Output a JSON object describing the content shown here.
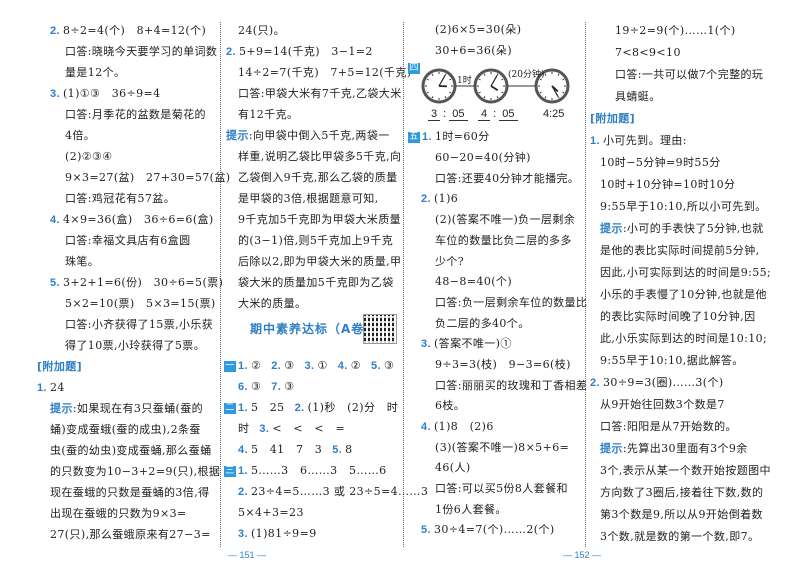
{
  "columns": [
    [
      {
        "type": "q",
        "n": "2.",
        "t": "8÷2=4(个)　8+4=12(个)"
      },
      {
        "type": "c",
        "t": "口答:晓晓今天要学习的单词数"
      },
      {
        "type": "c",
        "t": "量是12个。"
      },
      {
        "type": "q",
        "n": "3.",
        "t": "(1)①③　36÷9=4"
      },
      {
        "type": "c",
        "t": "口答:月季花的盆数是菊花的"
      },
      {
        "type": "c",
        "t": "4倍。"
      },
      {
        "type": "c",
        "t": "(2)②③④"
      },
      {
        "type": "c",
        "t": "9×3=27(盆)　27+30=57(盆)"
      },
      {
        "type": "c",
        "t": "口答:鸡冠花有57盆。"
      },
      {
        "type": "q",
        "n": "4.",
        "t": "4×9=36(盒)　36÷6=6(盒)"
      },
      {
        "type": "c",
        "t": "口答:幸福文具店有6盒圆"
      },
      {
        "type": "c",
        "t": "珠笔。"
      },
      {
        "type": "q",
        "n": "5.",
        "t": "3+2+1=6(份)　30÷6=5(票)"
      },
      {
        "type": "c",
        "t": "5×2=10(票)　5×3=15(票)"
      },
      {
        "type": "c",
        "t": "口答:小齐获得了15票,小乐获"
      },
      {
        "type": "c",
        "t": "得了10票,小玲获得了5票。"
      },
      {
        "type": "h",
        "t": "[附加题]"
      },
      {
        "type": "q0",
        "n": "1.",
        "t": "24"
      },
      {
        "type": "t",
        "tip": "提示",
        "t": ":如果现在有3只蚕蛹(蚕的"
      },
      {
        "type": "c1",
        "t": "蛹)变成蚕蛾(蚕的成虫),2条蚕"
      },
      {
        "type": "c1",
        "t": "虫(蚕的幼虫)变成蚕蛹,那么蚕蛹"
      },
      {
        "type": "c1",
        "t": "的只数变为10−3+2=9(只),根据"
      },
      {
        "type": "c1",
        "t": "现在蚕蛾的只数是蚕蛹的3倍,得"
      },
      {
        "type": "c1",
        "t": "出现在蚕蛾的只数为9×3="
      },
      {
        "type": "c1",
        "t": "27(只),那么蚕蛾原来有27−3="
      }
    ],
    [
      {
        "type": "c",
        "t": "24(只)。"
      },
      {
        "type": "q",
        "n": "2.",
        "t": "5+9=14(千克)　3−1=2"
      },
      {
        "type": "c",
        "t": "14÷2=7(千克)　7+5=12(千克)"
      },
      {
        "type": "c",
        "t": "口答:甲袋大米有7千克,乙袋大米"
      },
      {
        "type": "c",
        "t": "有12千克。"
      },
      {
        "type": "t",
        "tip": "提示",
        "t": ":向甲袋中倒入5千克,两袋一"
      },
      {
        "type": "c",
        "t": "样重,说明乙袋比甲袋多5千克,向"
      },
      {
        "type": "c",
        "t": "乙袋倒入9千克,那么乙袋的质量"
      },
      {
        "type": "c",
        "t": "是甲袋的3倍,根据题意可知,"
      },
      {
        "type": "c",
        "t": "9千克加5千克即为甲袋大米质量"
      },
      {
        "type": "c",
        "t": "的(3−1)倍,则5千克加上9千克"
      },
      {
        "type": "c",
        "t": "后除以2,即为甲袋大米的质量,甲"
      },
      {
        "type": "c",
        "t": "袋大米的质量加5千克即为乙袋"
      },
      {
        "type": "c",
        "t": "大米的质量。"
      },
      {
        "type": "title",
        "t": "期中素养达标（A卷）"
      },
      {
        "type": "s",
        "sec": "一",
        "parts": [
          {
            "n": "1.",
            "t": "②"
          },
          {
            "n": "2.",
            "t": "③"
          },
          {
            "n": "3.",
            "t": "①"
          },
          {
            "n": "4.",
            "t": "②"
          },
          {
            "n": "5.",
            "t": "③"
          }
        ]
      },
      {
        "type": "sc",
        "parts": [
          {
            "n": "6.",
            "t": "③"
          },
          {
            "n": "7.",
            "t": "③"
          }
        ]
      },
      {
        "type": "s",
        "sec": "二",
        "parts": [
          {
            "n": "1.",
            "t": "5　25"
          },
          {
            "n": "2.",
            "t": "(1)秒　(2)分　时"
          }
        ]
      },
      {
        "type": "sc",
        "parts": [
          {
            "t": "时"
          },
          {
            "n": "3.",
            "t": "<　<　<　="
          }
        ]
      },
      {
        "type": "sc",
        "parts": [
          {
            "n": "4.",
            "t": "5　41　7　3"
          },
          {
            "n": "5.",
            "t": "8"
          }
        ]
      },
      {
        "type": "s",
        "sec": "三",
        "parts": [
          {
            "n": "1.",
            "t": "5……3　6……3　5……6"
          }
        ]
      },
      {
        "type": "sc",
        "parts": [
          {
            "n": "2.",
            "t": "23÷4=5……3 或 23÷5=4……3"
          }
        ]
      },
      {
        "type": "c",
        "t": "5×4+3=23"
      },
      {
        "type": "sc",
        "parts": [
          {
            "n": "3.",
            "t": "(1)81÷9=9"
          }
        ]
      }
    ],
    [
      {
        "type": "c",
        "t": "(2)6×5=30(朵)"
      },
      {
        "type": "c",
        "t": "30+6=36(朵)"
      },
      {
        "type": "clocks"
      },
      {
        "type": "s",
        "sec": "五",
        "parts": [
          {
            "n": "1.",
            "t": "1时=60分"
          }
        ]
      },
      {
        "type": "c",
        "t": "60−20=40(分钟)"
      },
      {
        "type": "c",
        "t": "口答:还要40分钟才能播完。"
      },
      {
        "type": "q",
        "n": "2.",
        "t": "(1)6"
      },
      {
        "type": "c",
        "t": "(2)(答案不唯一)负一层剩余"
      },
      {
        "type": "c",
        "t": "车位的数量比负二层的多多"
      },
      {
        "type": "c",
        "t": "少个?"
      },
      {
        "type": "c",
        "t": "48−8=40(个)"
      },
      {
        "type": "c",
        "t": "口答:负一层剩余车位的数量比"
      },
      {
        "type": "c",
        "t": "负二层的多40个。"
      },
      {
        "type": "q",
        "n": "3.",
        "t": "(答案不唯一)①"
      },
      {
        "type": "c",
        "t": "9÷3=3(枝)　9−3=6(枝)"
      },
      {
        "type": "c",
        "t": "口答:丽丽买的玫瑰和丁香相差"
      },
      {
        "type": "c",
        "t": "6枝。"
      },
      {
        "type": "q",
        "n": "4.",
        "t": "(1)8　(2)6"
      },
      {
        "type": "c",
        "t": "(3)(答案不唯一)8×5+6="
      },
      {
        "type": "c",
        "t": "46(人)"
      },
      {
        "type": "c",
        "t": "口答:可以买5份8人套餐和"
      },
      {
        "type": "c",
        "t": "1份6人套餐。"
      },
      {
        "type": "q",
        "n": "5.",
        "t": "30÷4=7(个)……2(个)"
      }
    ],
    [
      {
        "type": "c",
        "t": "19÷2=9(个)……1(个)"
      },
      {
        "type": "c",
        "t": "7<8<9<10"
      },
      {
        "type": "c",
        "t": "口答:一共可以做7个完整的玩"
      },
      {
        "type": "c",
        "t": "具蜻蜓。"
      },
      {
        "type": "h",
        "t": "[附加题]"
      },
      {
        "type": "q0",
        "n": "1.",
        "t": "小可先到。理由:"
      },
      {
        "type": "c1",
        "t": "10时−5分钟=9时55分"
      },
      {
        "type": "c1",
        "t": "10时+10分钟=10时10分"
      },
      {
        "type": "c1",
        "t": "9:55早于10:10,所以小可先到。"
      },
      {
        "type": "t",
        "tip": "提示",
        "t": ":小可的手表快了5分钟,也就"
      },
      {
        "type": "c1",
        "t": "是他的表比实际时间提前5分钟,"
      },
      {
        "type": "c1",
        "t": "因此,小可实际到达的时间是9:55;"
      },
      {
        "type": "c1",
        "t": "小乐的手表慢了10分钟,也就是他"
      },
      {
        "type": "c1",
        "t": "的表比实际时间晚了10分钟,因"
      },
      {
        "type": "c1",
        "t": "此,小乐实际到达的时间是10:10;"
      },
      {
        "type": "c1",
        "t": "9:55早于10:10,据此解答。"
      },
      {
        "type": "q0",
        "n": "2.",
        "t": "30÷9=3(圈)……3(个)"
      },
      {
        "type": "c1",
        "t": "从9开始往回数3个数是7"
      },
      {
        "type": "c1",
        "t": "口答:阳阳是从7开始数的。"
      },
      {
        "type": "t",
        "tip": "提示",
        "t": ":先算出30里面有3个9余"
      },
      {
        "type": "c1",
        "t": "3个,表示从某一个数开始按题图中"
      },
      {
        "type": "c1",
        "t": "方向数了3圈后,接着往下数,数的"
      },
      {
        "type": "c1",
        "t": "第3个数是9,所以从9开始倒着数"
      },
      {
        "type": "c1",
        "t": "3个数,就是数的第一个数,即7。"
      }
    ]
  ],
  "clock_section": {
    "sec": "四",
    "clocks": [
      {
        "hour": 3,
        "minute": 5,
        "label_hour": "3",
        "label_min": "05"
      },
      {
        "hour": 4,
        "minute": 5,
        "label_hour": "4",
        "label_min": "05"
      },
      {
        "hour": 4,
        "minute": 25,
        "label": "4:25"
      }
    ],
    "arrows": [
      "1时",
      "(20分钟)"
    ]
  },
  "footer": {
    "left_page": "— 151 —",
    "right_page": "— 152 —"
  }
}
